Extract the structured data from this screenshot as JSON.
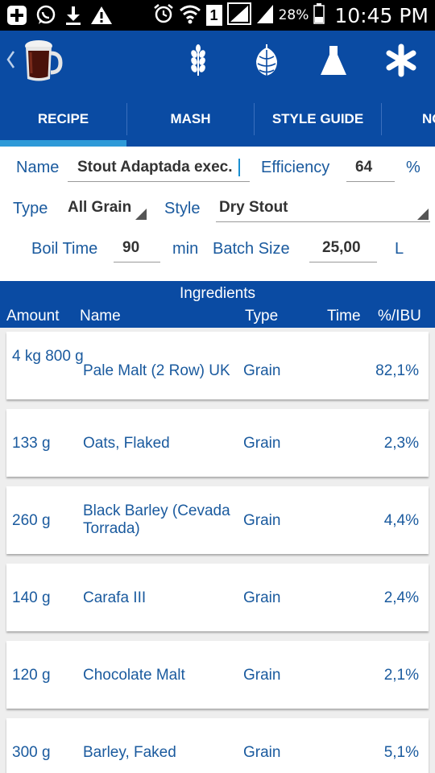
{
  "status_bar": {
    "battery_percent": "28%",
    "time": "10:45 PM",
    "sim_slot": "1",
    "icons": [
      "add-notification-icon",
      "whatsapp-icon",
      "download-icon",
      "warning-icon",
      "alarm-icon",
      "wifi-icon",
      "sim-icon",
      "signal-icon",
      "battery-icon"
    ]
  },
  "action_bar": {
    "icons": [
      "beer-mug-icon",
      "wheat-icon",
      "hops-icon",
      "flask-icon",
      "snowflake-icon"
    ]
  },
  "tabs": [
    {
      "label": "RECIPE",
      "active": true
    },
    {
      "label": "MASH",
      "active": false
    },
    {
      "label": "STYLE GUIDE",
      "active": false
    },
    {
      "label": "NO",
      "active": false
    }
  ],
  "colors": {
    "primary_blue": "#0a4ba3",
    "tab_indicator": "#2e9ad8",
    "label_blue": "#1a5a9e",
    "list_background": "#eeeeee"
  },
  "form": {
    "name_label": "Name",
    "name_value": "Stout Adaptada exec.",
    "efficiency_label": "Efficiency",
    "efficiency_value": "64",
    "efficiency_unit": "%",
    "type_label": "Type",
    "type_value": "All Grain",
    "style_label": "Style",
    "style_value": "Dry Stout",
    "boil_time_label": "Boil Time",
    "boil_time_value": "90",
    "boil_time_unit": "min",
    "batch_size_label": "Batch Size",
    "batch_size_value": "25,00",
    "batch_size_unit": "L"
  },
  "ingredients": {
    "title": "Ingredients",
    "columns": [
      "Amount",
      "Name",
      "Type",
      "Time",
      "%/IBU"
    ],
    "rows": [
      {
        "amount": "4 kg 800 g",
        "name": "Pale Malt (2 Row) UK",
        "type": "Grain",
        "time": "",
        "pct": "82,1%"
      },
      {
        "amount": "133 g",
        "name": "Oats, Flaked",
        "type": "Grain",
        "time": "",
        "pct": "2,3%"
      },
      {
        "amount": "260 g",
        "name": "Black Barley (Cevada Torrada)",
        "type": "Grain",
        "time": "",
        "pct": "4,4%"
      },
      {
        "amount": "140 g",
        "name": "Carafa III",
        "type": "Grain",
        "time": "",
        "pct": "2,4%"
      },
      {
        "amount": "120 g",
        "name": "Chocolate Malt",
        "type": "Grain",
        "time": "",
        "pct": "2,1%"
      },
      {
        "amount": "300 g",
        "name": "Barley, Faked",
        "type": "Grain",
        "time": "",
        "pct": "5,1%"
      }
    ]
  }
}
